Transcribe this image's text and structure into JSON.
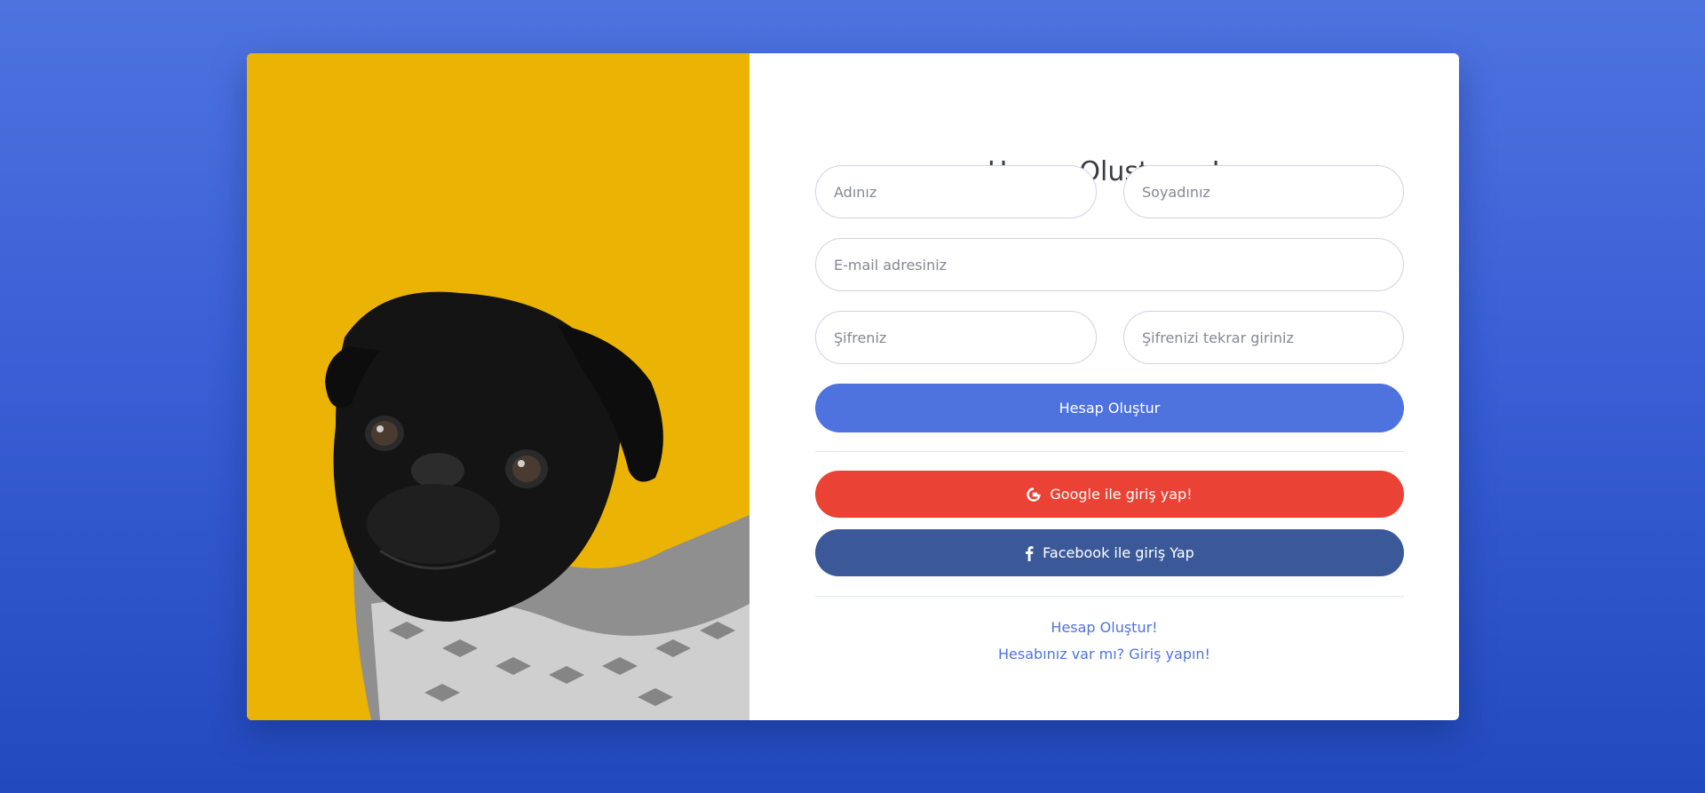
{
  "form": {
    "title": "Hesap Oluşturun!",
    "first_name_placeholder": "Adınız",
    "last_name_placeholder": "Soyadınız",
    "email_placeholder": "E-mail adresiniz",
    "password_placeholder": "Şifreniz",
    "repeat_password_placeholder": "Şifrenizi tekrar giriniz",
    "register_button": "Hesap Oluştur",
    "google_button": "Google ile giriş yap!",
    "facebook_button": "Facebook ile giriş Yap",
    "create_account_link": "Hesap Oluştur!",
    "login_link": "Hesabınız var mı? Giriş yapın!"
  },
  "icons": {
    "google": "google-icon",
    "facebook": "facebook-icon"
  },
  "colors": {
    "primary": "#4e73df",
    "google": "#ea4335",
    "facebook": "#3b5998",
    "image_background": "#ebb303"
  }
}
